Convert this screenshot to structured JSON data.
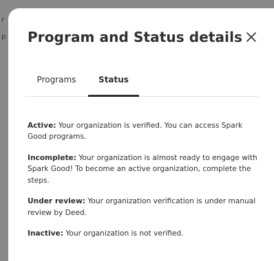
{
  "backdrop": {
    "fragments": [
      "r",
      "p"
    ]
  },
  "modal": {
    "title": "Program and Status details",
    "close_icon": "close-icon",
    "tabs": [
      {
        "label": "Programs",
        "selected": false
      },
      {
        "label": "Status",
        "selected": true
      }
    ],
    "statuses": [
      {
        "term": "Active:",
        "description": "Your organization is verified. You can access Spark Good programs."
      },
      {
        "term": "Incomplete:",
        "description": "Your organization is almost ready to engage with Spark Good! To become an active organization, complete the steps."
      },
      {
        "term": "Under review:",
        "description": "Your organization verification is under manual review by Deed."
      },
      {
        "term": "Inactive:",
        "description": "Your organization is not verified."
      }
    ]
  },
  "colors": {
    "overlay": "#8a8a8a",
    "surface": "#ffffff",
    "text": "#2e2f32",
    "divider": "#e3e4e5"
  }
}
